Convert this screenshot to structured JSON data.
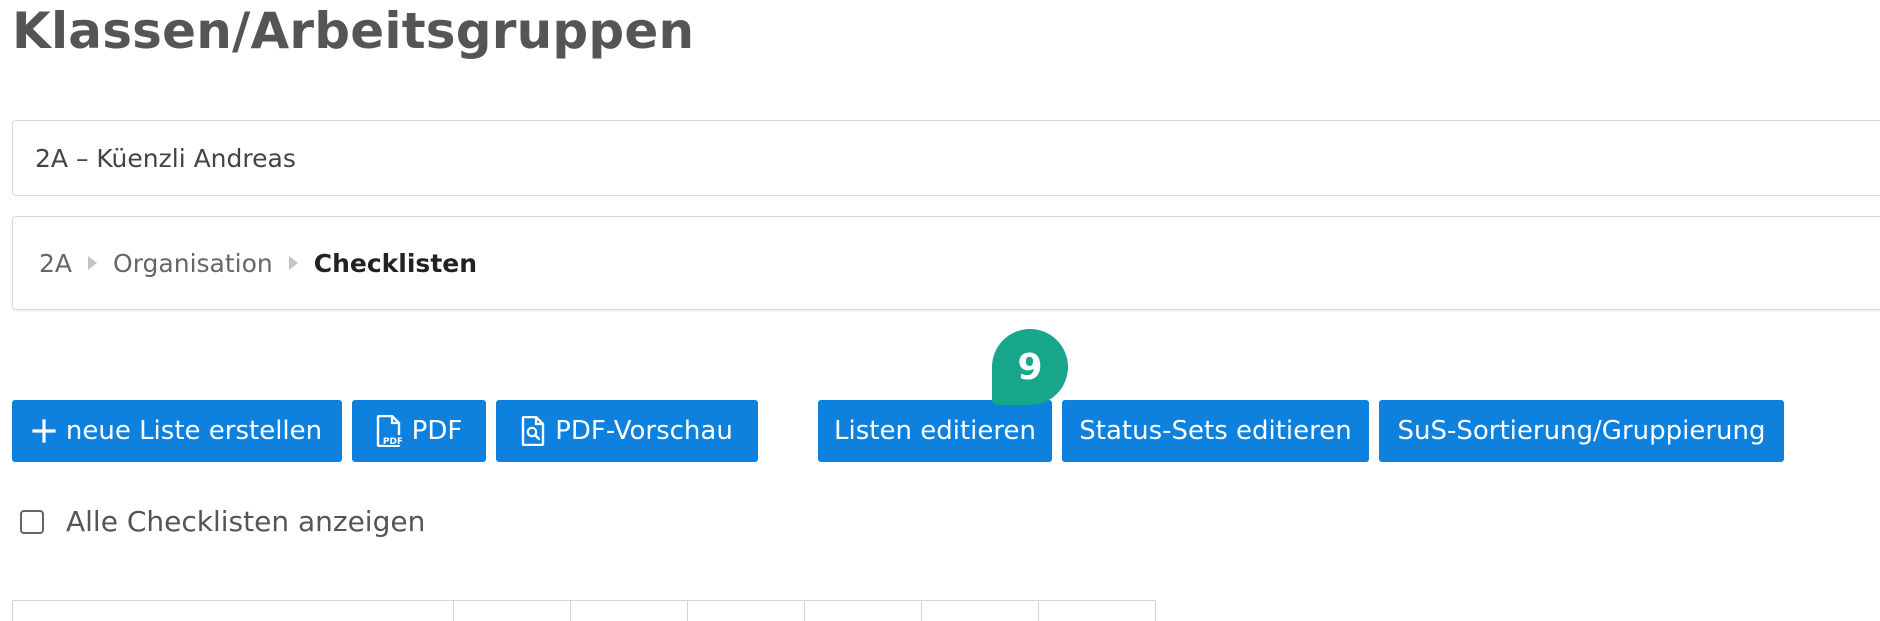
{
  "page": {
    "title": "Klassen/Arbeitsgruppen"
  },
  "class_select": {
    "value": "2A – Küenzli Andreas"
  },
  "breadcrumb": {
    "items": [
      "2A",
      "Organisation",
      "Checklisten"
    ]
  },
  "toolbar": {
    "new_list_label": "neue Liste erstellen",
    "pdf_label": "PDF",
    "pdf_preview_label": "PDF-Vorschau",
    "edit_lists_label": "Listen editieren",
    "edit_status_sets_label": "Status-Sets editieren",
    "sort_group_label": "SuS-Sortierung/Gruppierung"
  },
  "step_badge": {
    "number": "9",
    "color": "#17a58c"
  },
  "show_all": {
    "label": "Alle Checklisten anzeigen",
    "checked": false
  },
  "colors": {
    "button": "#0d81dd",
    "title": "#555555"
  }
}
